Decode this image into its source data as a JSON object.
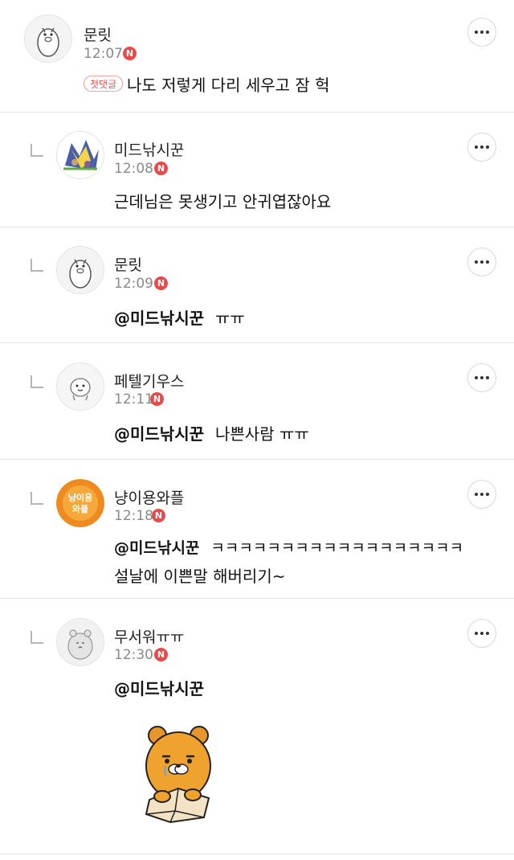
{
  "comments": [
    {
      "name": "문릿",
      "time": "12:07",
      "badge": "N",
      "first_label": "첫댓글",
      "text": "나도 저렇게 다리 세우고 잠 헉",
      "more": "more"
    },
    {
      "name": "미드낚시꾼",
      "time": "12:08",
      "badge": "N",
      "text": "근데님은 못생기고 안귀엽잖아요",
      "more": "more"
    },
    {
      "name": "문릿",
      "time": "12:09",
      "badge": "N",
      "mention": "@미드낚시꾼",
      "text": "ㅠㅠ",
      "more": "more"
    },
    {
      "name": "페텔기우스",
      "time": "12:11",
      "badge": "N",
      "mention": "@미드낚시꾼",
      "text": "나쁜사람 ㅠㅠ",
      "more": "more"
    },
    {
      "name": "냥이용와플",
      "time": "12:18",
      "badge": "N",
      "avatar_text": "냥이용 와플",
      "mention": "@미드낚시꾼",
      "text": "ㅋㅋㅋㅋㅋㅋㅋㅋㅋㅋㅋㅋㅋㅋㅋㅋㅋㅋ",
      "text2": "설날에 이쁜말 해버리기~",
      "more": "more"
    },
    {
      "name": "무서워ㅠㅠ",
      "time": "12:30",
      "badge": "N",
      "mention": "@미드낚시꾼",
      "more": "more"
    }
  ],
  "icons": {
    "more": "more-icon",
    "reply": "reply-arrow-icon",
    "sticker": "ryan-bear-sticker"
  },
  "colors": {
    "new_badge": "#e84a4a",
    "divider": "#e6e6e6",
    "time": "#8a8a8a"
  }
}
